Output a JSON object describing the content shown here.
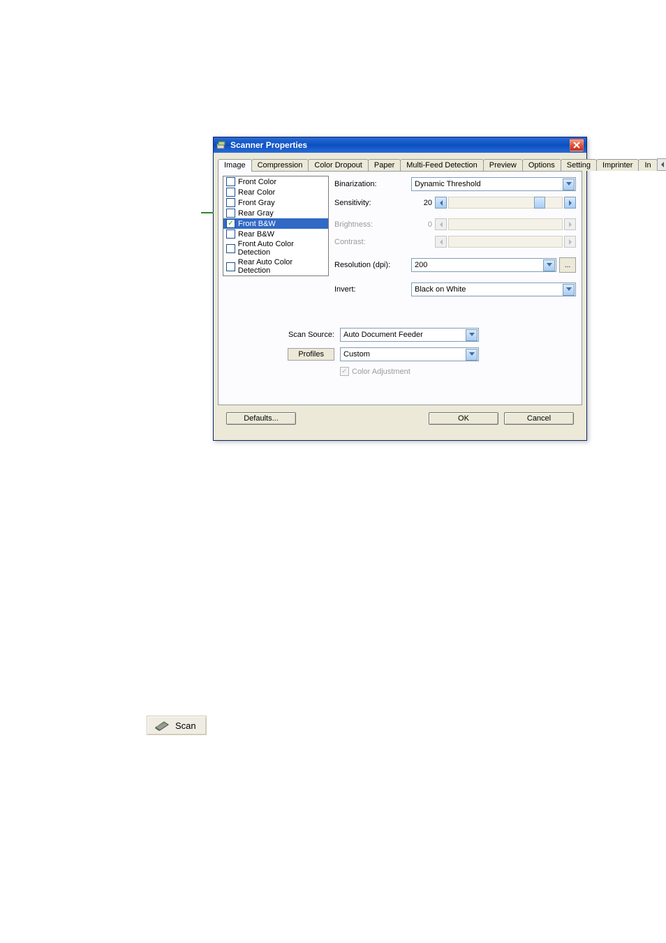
{
  "window": {
    "title": "Scanner Properties"
  },
  "tabs": {
    "image": "Image",
    "compression": "Compression",
    "color_dropout": "Color Dropout",
    "paper": "Paper",
    "multifeed": "Multi-Feed Detection",
    "preview": "Preview",
    "options": "Options",
    "setting": "Setting",
    "imprinter": "Imprinter",
    "info_trunc": "In"
  },
  "image_list": {
    "front_color": "Front Color",
    "rear_color": "Rear Color",
    "front_gray": "Front Gray",
    "rear_gray": "Rear Gray",
    "front_bw": "Front B&W",
    "rear_bw": "Rear B&W",
    "front_auto": "Front Auto Color Detection",
    "rear_auto": "Rear Auto Color Detection"
  },
  "settings": {
    "binarization_label": "Binarization:",
    "binarization_value": "Dynamic Threshold",
    "sensitivity_label": "Sensitivity:",
    "sensitivity_value": "20",
    "brightness_label": "Brightness:",
    "brightness_value": "0",
    "contrast_label": "Contrast:",
    "resolution_label": "Resolution (dpi):",
    "resolution_value": "200",
    "invert_label": "Invert:",
    "invert_value": "Black on White"
  },
  "lower": {
    "scan_source_label": "Scan Source:",
    "scan_source_value": "Auto Document Feeder",
    "profiles_button": "Profiles",
    "profiles_value": "Custom",
    "color_adj_label": "Color Adjustment"
  },
  "buttons": {
    "defaults": "Defaults...",
    "ok": "OK",
    "cancel": "Cancel",
    "more": "..."
  },
  "scan_button": "Scan"
}
